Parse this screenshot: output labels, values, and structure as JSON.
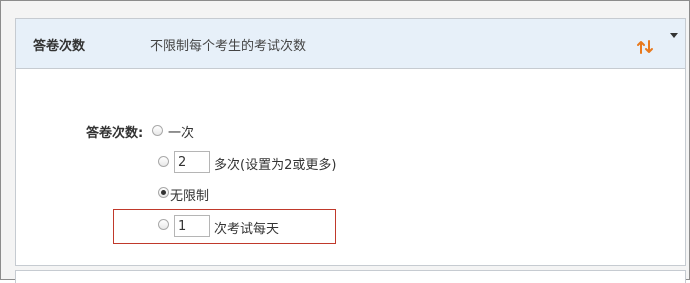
{
  "header": {
    "title": "答卷次数",
    "summary": "不限制每个考生的考试次数",
    "accent_color": "#e8791d"
  },
  "form": {
    "label": "答卷次数:",
    "options": [
      {
        "text": "一次",
        "checked": false
      },
      {
        "value": "2",
        "text": "多次(设置为2或更多)",
        "checked": false
      },
      {
        "text": "无限制",
        "checked": true
      },
      {
        "value": "1",
        "text": "次考试每天",
        "checked": false
      }
    ],
    "highlight_color": "#c0392b"
  },
  "icons": {
    "swap": "swap-vertical-icon",
    "caret": "caret-down-icon"
  }
}
